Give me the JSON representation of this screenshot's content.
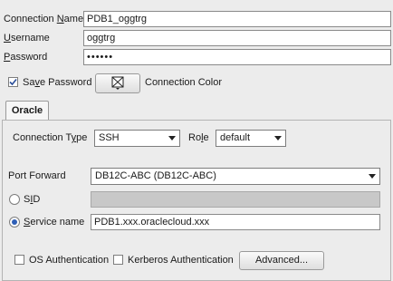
{
  "connection": {
    "name_label": "Connection Name",
    "name_value": "PDB1_oggtrg",
    "username_label": "Username",
    "username_value": "oggtrg",
    "password_label": "Password",
    "password_value": "••••••"
  },
  "save_password": {
    "label": "Save Password",
    "checked": true
  },
  "connection_color": {
    "label": "Connection Color"
  },
  "tab": {
    "label": "Oracle"
  },
  "oracle": {
    "connection_type_label": "Connection Type",
    "connection_type_value": "SSH",
    "role_label": "Role",
    "role_value": "default",
    "port_forward_label": "Port Forward",
    "port_forward_value": "DB12C-ABC (DB12C-ABC)",
    "sid_label": "SID",
    "sid_value": "",
    "service_name_label": "Service name",
    "service_name_value": "PDB1.xxx.oraclecloud.xxx",
    "os_auth_label": "OS Authentication",
    "kerberos_label": "Kerberos Authentication",
    "advanced_label": "Advanced..."
  },
  "colors": {
    "radio_selected": "#2f5fb6",
    "check_blue": "#2b4f9a"
  }
}
